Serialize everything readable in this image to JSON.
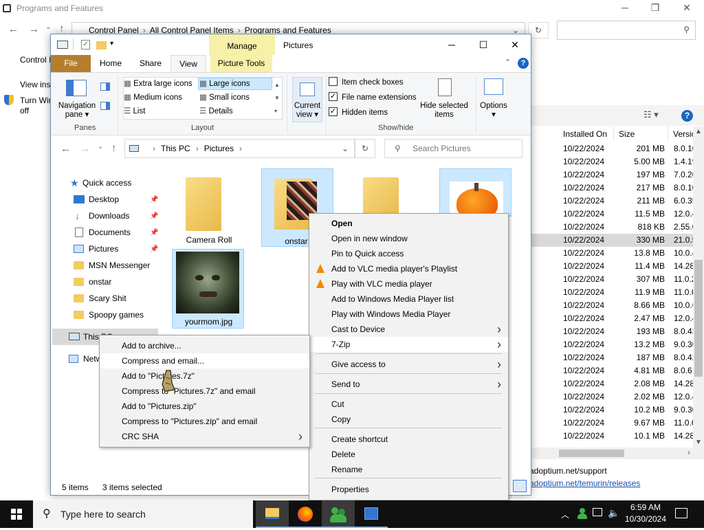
{
  "bg_window": {
    "title": "Programs and Features",
    "breadcrumb": [
      "Control Panel",
      "All Control Panel Items",
      "Programs and Features"
    ],
    "left_links": [
      "Control I",
      "View inst",
      "Turn Wir",
      "off"
    ],
    "columns": [
      "Installed On",
      "Size",
      "Versio"
    ],
    "rows": [
      {
        "date": "10/22/2024",
        "size": "201 MB",
        "version": "8.0.10"
      },
      {
        "date": "10/22/2024",
        "size": "5.00 MB",
        "version": "1.4.19"
      },
      {
        "date": "10/22/2024",
        "size": "197 MB",
        "version": "7.0.20"
      },
      {
        "date": "10/22/2024",
        "size": "217 MB",
        "version": "8.0.10"
      },
      {
        "date": "10/22/2024",
        "size": "211 MB",
        "version": "6.0.35"
      },
      {
        "date": "10/22/2024",
        "size": "11.5 MB",
        "version": "12.0.4"
      },
      {
        "date": "10/22/2024",
        "size": "818 KB",
        "version": "2.55.0"
      },
      {
        "date": "10/22/2024",
        "size": "330 MB",
        "version": "21.0.5"
      },
      {
        "date": "10/22/2024",
        "size": "13.8 MB",
        "version": "10.0.4"
      },
      {
        "date": "10/22/2024",
        "size": "11.4 MB",
        "version": "14.28"
      },
      {
        "date": "10/22/2024",
        "size": "307 MB",
        "version": "11.0.2"
      },
      {
        "date": "10/22/2024",
        "size": "11.9 MB",
        "version": "11.0.6"
      },
      {
        "date": "10/22/2024",
        "size": "8.66 MB",
        "version": "10.0.6"
      },
      {
        "date": "10/22/2024",
        "size": "2.47 MB",
        "version": "12.0.4"
      },
      {
        "date": "10/22/2024",
        "size": "193 MB",
        "version": "8.0.43"
      },
      {
        "date": "10/22/2024",
        "size": "13.2 MB",
        "version": "9.0.30"
      },
      {
        "date": "10/22/2024",
        "size": "187 MB",
        "version": "8.0.42"
      },
      {
        "date": "10/22/2024",
        "size": "4.81 MB",
        "version": "8.0.61"
      },
      {
        "date": "10/22/2024",
        "size": "2.08 MB",
        "version": "14.28"
      },
      {
        "date": "10/22/2024",
        "size": "2.02 MB",
        "version": "12.0.4"
      },
      {
        "date": "10/22/2024",
        "size": "10.2 MB",
        "version": "9.0.30"
      },
      {
        "date": "10/22/2024",
        "size": "9.67 MB",
        "version": "11.0.6"
      },
      {
        "date": "10/22/2024",
        "size": "10.1 MB",
        "version": "14.28"
      }
    ],
    "selected_row_index": 7,
    "links": [
      "adoptium.net/support",
      "adoptium.net/temurin/releases"
    ]
  },
  "explorer": {
    "title": "Pictures",
    "manage_label": "Manage",
    "tabs": [
      "File",
      "Home",
      "Share",
      "View",
      "Picture Tools"
    ],
    "ribbon": {
      "nav_pane": "Navigation pane",
      "panes_label": "Panes",
      "layout_items": [
        "Extra large icons",
        "Large icons",
        "Medium icons",
        "Small icons",
        "List",
        "Details"
      ],
      "layout_label": "Layout",
      "current_view": "Current view",
      "show_hide": {
        "item_check_boxes": "Item check boxes",
        "file_name_extensions": "File name extensions",
        "hidden_items": "Hidden items",
        "hide_selected": "Hide selected items",
        "label": "Show/hide"
      },
      "options": "Options"
    },
    "address": [
      "This PC",
      "Pictures"
    ],
    "search_placeholder": "Search Pictures",
    "nav_pane": {
      "quick_access": "Quick access",
      "items": [
        "Desktop",
        "Downloads",
        "Documents",
        "Pictures",
        "MSN Messenger",
        "onstar",
        "Scary Shit",
        "Spoopy games"
      ],
      "this_pc": "This PC",
      "network": "Netw"
    },
    "files": [
      {
        "name": "Camera Roll"
      },
      {
        "name": "onstar"
      },
      {
        "name": ""
      },
      {
        "name": ""
      },
      {
        "name": "yourmom.jpg"
      }
    ],
    "status": {
      "count": "5 items",
      "selected": "3 items selected"
    }
  },
  "context_menu": {
    "items": [
      {
        "label": "Open",
        "bold": true
      },
      {
        "label": "Open in new window"
      },
      {
        "label": "Pin to Quick access"
      },
      {
        "label": "Add to VLC media player's Playlist",
        "icon": "vlc-icon"
      },
      {
        "label": "Play with VLC media player",
        "icon": "vlc-icon"
      },
      {
        "label": "Add to Windows Media Player list"
      },
      {
        "label": "Play with Windows Media Player"
      },
      {
        "label": "Cast to Device",
        "submenu": true
      },
      {
        "label": "7-Zip",
        "submenu": true
      },
      {
        "label": "Give access to",
        "submenu": true
      },
      {
        "label": "Send to",
        "submenu": true
      },
      {
        "label": "Cut"
      },
      {
        "label": "Copy"
      },
      {
        "label": "Create shortcut"
      },
      {
        "label": "Delete"
      },
      {
        "label": "Rename"
      },
      {
        "label": "Properties"
      }
    ]
  },
  "zip_menu": {
    "items": [
      {
        "label": "Add to archive..."
      },
      {
        "label": "Compress and email..."
      },
      {
        "label": "Add to \"Pictures.7z\""
      },
      {
        "label": "Compress to \"Pictures.7z\" and email"
      },
      {
        "label": "Add to \"Pictures.zip\""
      },
      {
        "label": "Compress to \"Pictures.zip\" and email"
      },
      {
        "label": "CRC SHA",
        "submenu": true
      }
    ]
  },
  "taskbar": {
    "search_placeholder": "Type here to search",
    "time": "6:59 AM",
    "date": "10/30/2024"
  },
  "colors": {
    "file_tab": "#b57d2c",
    "manage": "#f6f0a8",
    "selection": "#cce8ff",
    "taskbar": "#101010"
  }
}
